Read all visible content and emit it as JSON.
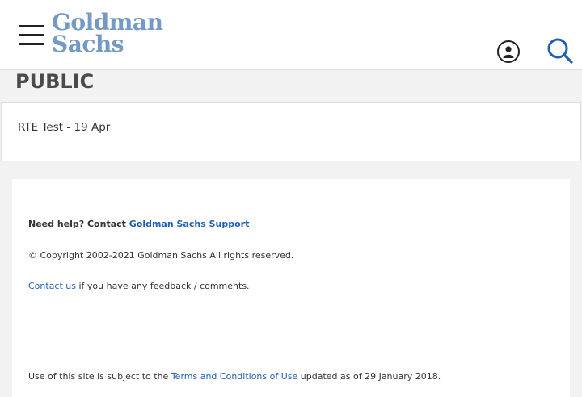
{
  "header": {
    "logo_line1": "Goldman",
    "logo_line2": "Sachs",
    "menu_icon": "hamburger-icon",
    "user_icon": "user-icon",
    "search_icon": "search-icon",
    "brand_color": "#7399c6",
    "accent_color": "#1f5fb8"
  },
  "page": {
    "title": "PUBLIC"
  },
  "content": {
    "items": [
      {
        "label": "RTE Test - 19 Apr"
      }
    ]
  },
  "footer": {
    "help_prefix": "Need help? Contact ",
    "help_link": "Goldman Sachs Support",
    "copyright": "© Copyright 2002-2021 Goldman Sachs All rights reserved.",
    "contact_link": "Contact us",
    "contact_suffix": " if you have any feedback / comments.",
    "terms_prefix": "Use of this site is subject to the ",
    "terms_link": "Terms and Conditions of Use",
    "terms_suffix": " updated as of 29 January 2018."
  }
}
